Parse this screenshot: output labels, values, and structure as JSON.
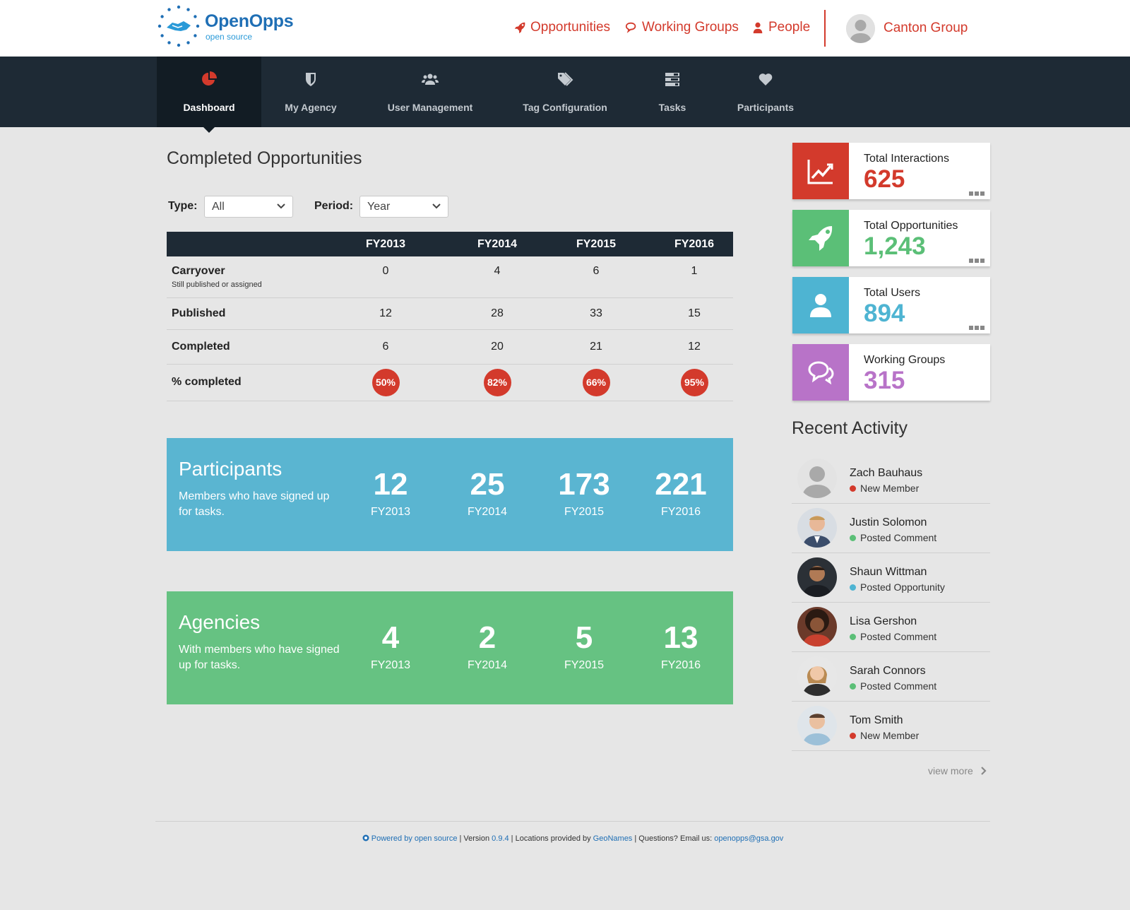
{
  "brand": {
    "name": "OpenOpps",
    "tagline": "open source"
  },
  "topnav": {
    "items": [
      {
        "label": "Opportunities",
        "icon": "rocket-icon"
      },
      {
        "label": "Working Groups",
        "icon": "comments-icon"
      },
      {
        "label": "People",
        "icon": "user-icon"
      }
    ],
    "user_name": "Canton Group"
  },
  "subnav": {
    "items": [
      {
        "label": "Dashboard",
        "icon": "pie-chart-icon",
        "active": true
      },
      {
        "label": "My Agency",
        "icon": "shield-icon"
      },
      {
        "label": "User Management",
        "icon": "users-icon"
      },
      {
        "label": "Tag Configuration",
        "icon": "tags-icon"
      },
      {
        "label": "Tasks",
        "icon": "tasks-icon"
      },
      {
        "label": "Participants",
        "icon": "heart-icon"
      }
    ]
  },
  "completed": {
    "title": "Completed Opportunities",
    "type_label": "Type:",
    "type_value": "All",
    "period_label": "Period:",
    "period_value": "Year",
    "columns": [
      "",
      "FY2013",
      "FY2014",
      "FY2015",
      "FY2016"
    ],
    "rows": [
      {
        "label": "Carryover",
        "sub": "Still published or assigned",
        "values": [
          "0",
          "4",
          "6",
          "1"
        ]
      },
      {
        "label": "Published",
        "values": [
          "12",
          "28",
          "33",
          "15"
        ]
      },
      {
        "label": "Completed",
        "values": [
          "6",
          "20",
          "21",
          "12"
        ]
      },
      {
        "label": "% completed",
        "values": [
          "50%",
          "82%",
          "66%",
          "95%"
        ]
      }
    ]
  },
  "participants": {
    "title": "Participants",
    "desc": "Members who have signed up for tasks.",
    "values": [
      {
        "num": "12",
        "year": "FY2013"
      },
      {
        "num": "25",
        "year": "FY2014"
      },
      {
        "num": "173",
        "year": "FY2015"
      },
      {
        "num": "221",
        "year": "FY2016"
      }
    ]
  },
  "agencies": {
    "title": "Agencies",
    "desc": "With members who have signed up for tasks.",
    "values": [
      {
        "num": "4",
        "year": "FY2013"
      },
      {
        "num": "2",
        "year": "FY2014"
      },
      {
        "num": "5",
        "year": "FY2015"
      },
      {
        "num": "13",
        "year": "FY2016"
      }
    ]
  },
  "cards": [
    {
      "label": "Total Interactions",
      "value": "625",
      "color": "#d33a2c",
      "icon": "line-chart-icon"
    },
    {
      "label": "Total Opportunities",
      "value": "1,243",
      "color": "#5bbf77",
      "icon": "rocket-icon"
    },
    {
      "label": "Total Users",
      "value": "894",
      "color": "#4eb4d2",
      "icon": "user-icon"
    },
    {
      "label": "Working Groups",
      "value": "315",
      "color": "#b873c8",
      "icon": "comments-icon"
    }
  ],
  "activity": {
    "title": "Recent Activity",
    "items": [
      {
        "name": "Zach  Bauhaus",
        "status": "New Member",
        "dot": "#d33a2c"
      },
      {
        "name": "Justin Solomon",
        "status": "Posted Comment",
        "dot": "#5bbf77"
      },
      {
        "name": "Shaun Wittman",
        "status": "Posted Opportunity",
        "dot": "#4eb4d2"
      },
      {
        "name": "Lisa Gershon",
        "status": "Posted Comment",
        "dot": "#5bbf77"
      },
      {
        "name": "Sarah Connors",
        "status": "Posted Comment",
        "dot": "#5bbf77"
      },
      {
        "name": "Tom Smith",
        "status": "New Member",
        "dot": "#d33a2c"
      }
    ],
    "view_more": "view more"
  },
  "footer": {
    "powered": "Powered by open source",
    "version_prefix": " | Version ",
    "version": "0.9.4",
    "locations_prefix": " | Locations provided by ",
    "geonames": "GeoNames",
    "questions": " | Questions? Email us: ",
    "email": "openopps@gsa.gov"
  },
  "colors": {
    "accent": "#d33a2c",
    "navy": "#1e2a35",
    "participants_band": "#5ab5d1",
    "agencies_band": "#66c282"
  }
}
